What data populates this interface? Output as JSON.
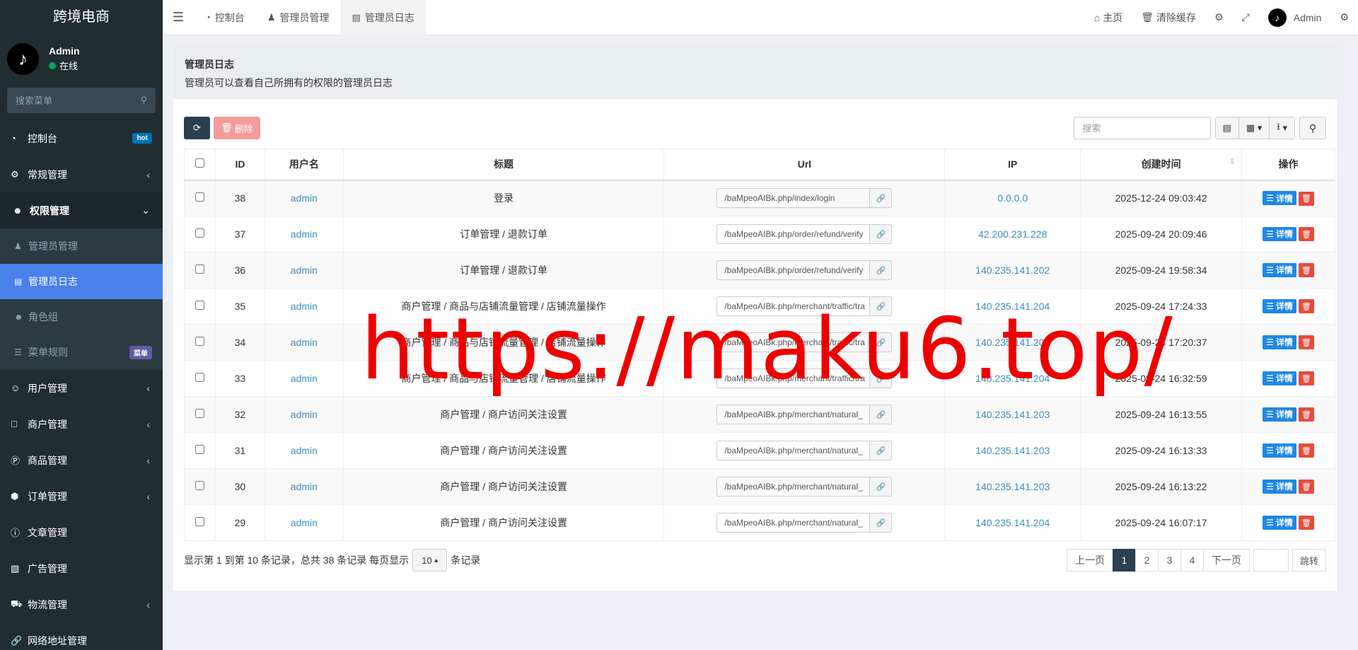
{
  "app": {
    "logo": "跨境电商"
  },
  "user": {
    "name": "Admin",
    "status": "在线",
    "avatar_glyph": "♪"
  },
  "sidebar": {
    "search_placeholder": "搜索菜单",
    "items": [
      {
        "label": "控制台",
        "icon": "dashboard-icon",
        "badge": "hot",
        "badge_color": "#0073b7"
      },
      {
        "label": "常规管理",
        "icon": "cogs-icon",
        "chev": "‹"
      },
      {
        "label": "权限管理",
        "icon": "group-icon",
        "chev": "⌄"
      }
    ],
    "subitems": [
      {
        "label": "管理员管理",
        "icon": "user-icon"
      },
      {
        "label": "管理员日志",
        "icon": "list-alt-icon"
      },
      {
        "label": "角色组",
        "icon": "group-icon"
      },
      {
        "label": "菜单规则",
        "icon": "bars-icon",
        "badge": "菜单"
      }
    ],
    "items2": [
      {
        "label": "用户管理",
        "icon": "user-circle-icon",
        "chev": "‹"
      },
      {
        "label": "商户管理",
        "icon": "apple-icon",
        "chev": "‹"
      },
      {
        "label": "商品管理",
        "icon": "product-hunt-icon",
        "chev": "‹"
      },
      {
        "label": "订单管理",
        "icon": "cube-icon",
        "chev": "‹"
      },
      {
        "label": "文章管理",
        "icon": "question-circle-icon"
      },
      {
        "label": "广告管理",
        "icon": "cc-icon"
      },
      {
        "label": "物流管理",
        "icon": "truck-icon",
        "chev": "‹"
      },
      {
        "label": "网络地址管理",
        "icon": "link-icon"
      }
    ]
  },
  "topbar": {
    "tabs": [
      {
        "label": "控制台"
      },
      {
        "label": "管理员管理"
      },
      {
        "label": "管理员日志"
      }
    ],
    "home": "主页",
    "clear_cache": "清除缓存",
    "admin": "Admin"
  },
  "panel": {
    "title": "管理员日志",
    "desc": "管理员可以查看自己所拥有的权限的管理员日志"
  },
  "toolbar": {
    "delete_label": "删除",
    "search_placeholder": "搜索"
  },
  "table": {
    "headers": [
      "ID",
      "用户名",
      "标题",
      "Url",
      "IP",
      "创建时间",
      "操作"
    ],
    "detail_label": "详情",
    "rows": [
      {
        "id": "38",
        "user": "admin",
        "title": "登录",
        "url": "/baMpeoAIBk.php/index/login",
        "ip": "0.0.0.0",
        "time": "2025-12-24 09:03:42"
      },
      {
        "id": "37",
        "user": "admin",
        "title": "订单管理 / 退款订单",
        "url": "/baMpeoAIBk.php/order/refund/verify",
        "ip": "42.200.231.228",
        "time": "2025-09-24 20:09:46"
      },
      {
        "id": "36",
        "user": "admin",
        "title": "订单管理 / 退款订单",
        "url": "/baMpeoAIBk.php/order/refund/verify",
        "ip": "140.235.141.202",
        "time": "2025-09-24 19:58:34"
      },
      {
        "id": "35",
        "user": "admin",
        "title": "商户管理 / 商品与店铺流量管理 / 店铺流量操作",
        "url": "/baMpeoAIBk.php/merchant/traffic/tra",
        "ip": "140.235.141.204",
        "time": "2025-09-24 17:24:33"
      },
      {
        "id": "34",
        "user": "admin",
        "title": "商户管理 / 商品与店铺流量管理 / 店铺流量操作",
        "url": "/baMpeoAIBk.php/merchant/traffic/tra",
        "ip": "140.235.141.204",
        "time": "2025-09-24 17:20:37"
      },
      {
        "id": "33",
        "user": "admin",
        "title": "商户管理 / 商品与店铺流量管理 / 店铺流量操作",
        "url": "/baMpeoAIBk.php/merchant/traffic/tra",
        "ip": "140.235.141.204",
        "time": "2025-09-24 16:32:59"
      },
      {
        "id": "32",
        "user": "admin",
        "title": "商户管理 / 商户访问关注设置",
        "url": "/baMpeoAIBk.php/merchant/natural_",
        "ip": "140.235.141.203",
        "time": "2025-09-24 16:13:55"
      },
      {
        "id": "31",
        "user": "admin",
        "title": "商户管理 / 商户访问关注设置",
        "url": "/baMpeoAIBk.php/merchant/natural_",
        "ip": "140.235.141.203",
        "time": "2025-09-24 16:13:33"
      },
      {
        "id": "30",
        "user": "admin",
        "title": "商户管理 / 商户访问关注设置",
        "url": "/baMpeoAIBk.php/merchant/natural_",
        "ip": "140.235.141.203",
        "time": "2025-09-24 16:13:22"
      },
      {
        "id": "29",
        "user": "admin",
        "title": "商户管理 / 商户访问关注设置",
        "url": "/baMpeoAIBk.php/merchant/natural_",
        "ip": "140.235.141.204",
        "time": "2025-09-24 16:07:17"
      }
    ]
  },
  "footer": {
    "summary": "显示第 1 到第 10 条记录，总共 38 条记录 每页显示",
    "page_size": "10",
    "suffix": "条记录",
    "prev": "上一页",
    "pages": [
      "1",
      "2",
      "3",
      "4"
    ],
    "next": "下一页",
    "jump": "跳转"
  },
  "watermark": "https://maku6.top/"
}
